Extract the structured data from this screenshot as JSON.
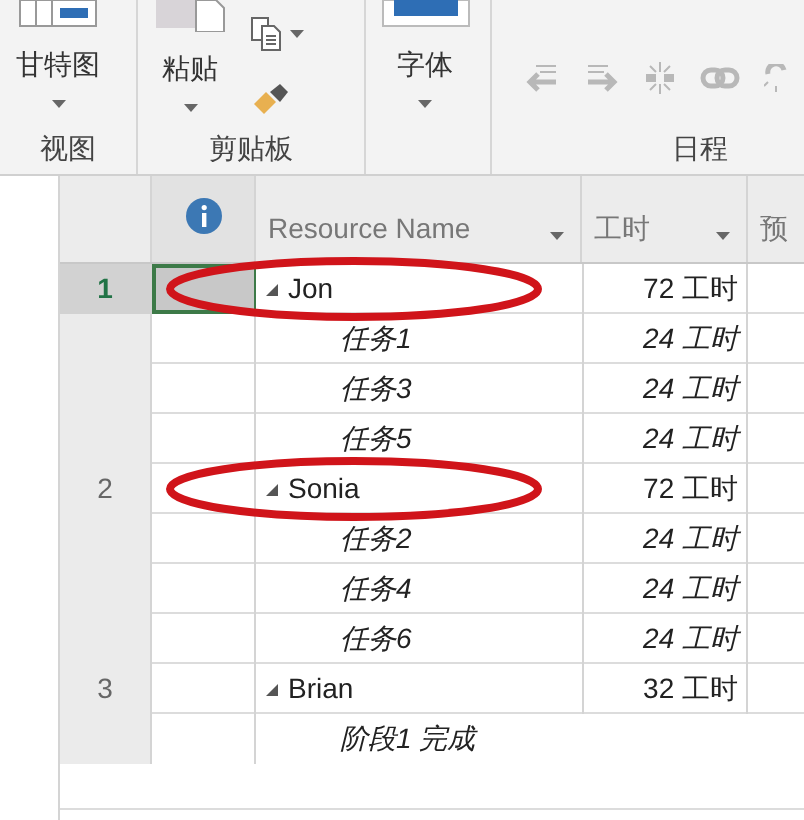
{
  "ribbon": {
    "groups": [
      {
        "label": "视图",
        "buttons": [
          {
            "kind": "gantt",
            "label": "甘特图",
            "dropdown": true
          }
        ]
      },
      {
        "label": "剪贴板",
        "buttons": [
          {
            "kind": "paste",
            "label": "粘贴",
            "dropdown": true
          },
          {
            "kind": "copy",
            "dropdown": true
          },
          {
            "kind": "painter"
          }
        ]
      },
      {
        "buttons": [
          {
            "kind": "font",
            "label": "字体",
            "dropdown": true
          }
        ]
      },
      {
        "label": "日程",
        "buttons": [
          {
            "kind": "outdent"
          },
          {
            "kind": "indent"
          },
          {
            "kind": "split"
          },
          {
            "kind": "link"
          },
          {
            "kind": "unlink"
          }
        ]
      }
    ]
  },
  "grid": {
    "columns": [
      {
        "label": "Resource Name",
        "filter": true
      },
      {
        "label": "工时",
        "filter": true
      },
      {
        "label": "预"
      }
    ],
    "rows": [
      {
        "kind": "resource",
        "number": "1",
        "name": "Jon",
        "work": "72 工时",
        "selected": true,
        "circled": true
      },
      {
        "kind": "assignment",
        "name": "任务1",
        "work": "24 工时",
        "selected": false
      },
      {
        "kind": "assignment",
        "name": "任务3",
        "work": "24 工时",
        "selected": false
      },
      {
        "kind": "assignment",
        "name": "任务5",
        "work": "24 工时",
        "selected": false
      },
      {
        "kind": "resource",
        "number": "2",
        "name": "Sonia",
        "work": "72 工时",
        "selected": false,
        "circled": true
      },
      {
        "kind": "assignment",
        "name": "任务2",
        "work": "24 工时",
        "selected": false
      },
      {
        "kind": "assignment",
        "name": "任务4",
        "work": "24 工时",
        "selected": false
      },
      {
        "kind": "assignment",
        "name": "任务6",
        "work": "24 工时",
        "selected": false
      },
      {
        "kind": "resource",
        "number": "3",
        "name": "Brian",
        "work": "32 工时",
        "selected": false
      },
      {
        "kind": "assignment",
        "name": "阶段1 完成",
        "selected": false,
        "tall": true
      }
    ]
  }
}
